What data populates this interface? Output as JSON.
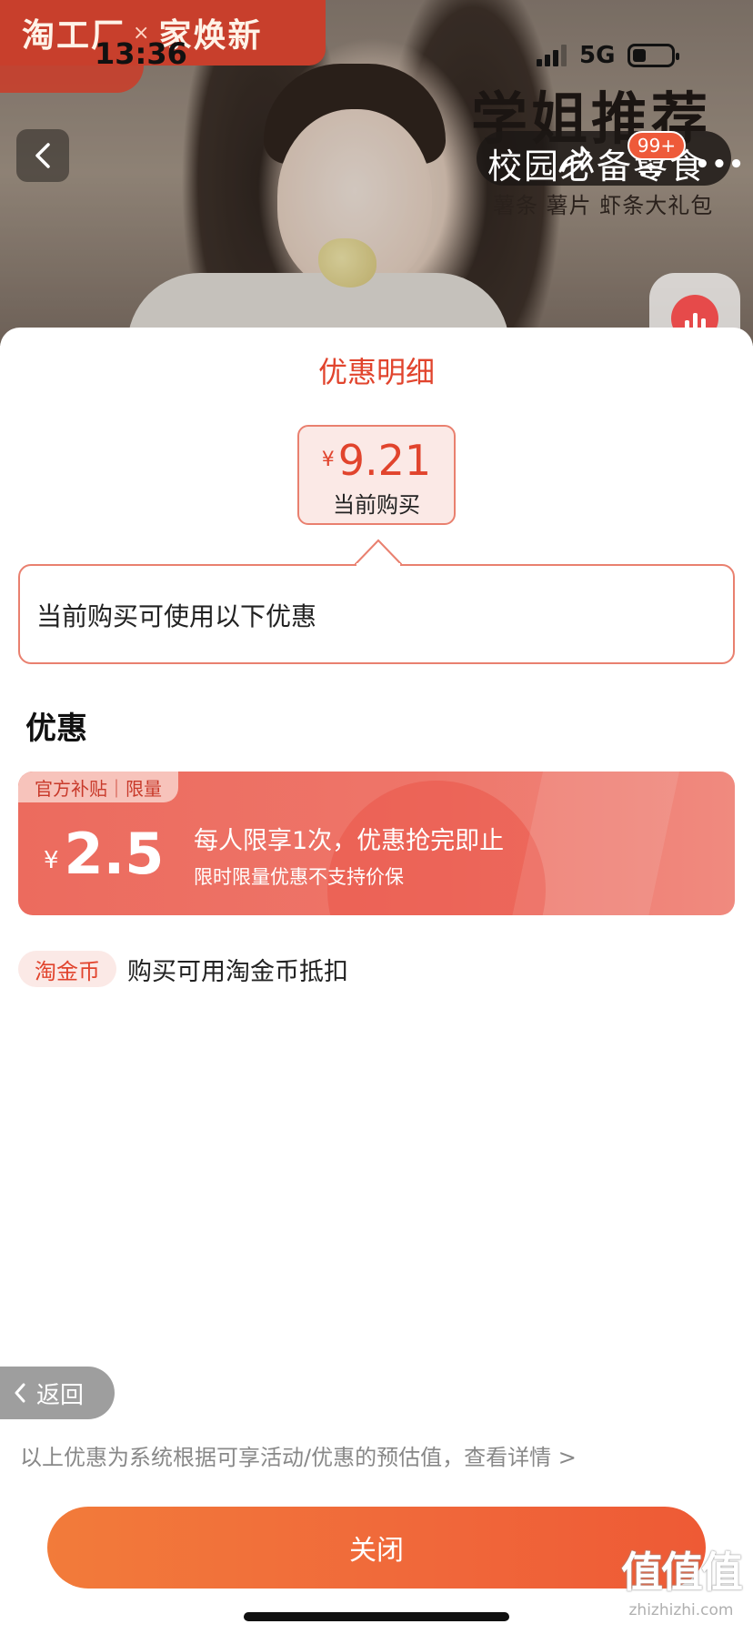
{
  "status_bar": {
    "time": "13:36",
    "network": "5G"
  },
  "banner": {
    "brand_left": "淘工厂",
    "brand_sep": "×",
    "brand_right": "家焕新",
    "promo_title": "学姐推荐",
    "promo_pill": "校园必备零食",
    "promo_sub": "薯条 薯片 虾条大礼包",
    "cart_badge": "99+"
  },
  "sheet": {
    "title": "优惠明细",
    "price": {
      "currency": "¥",
      "amount": "9.21",
      "caption": "当前购买"
    },
    "tip": "当前购买可使用以下优惠",
    "section_title": "优惠",
    "coupon": {
      "tag": "官方补贴｜限量",
      "currency": "¥",
      "amount": "2.5",
      "main_text": "每人限享1次，优惠抢完即止",
      "sub_text": "限时限量优惠不支持价保"
    },
    "coin": {
      "badge": "淘金币",
      "text": "购买可用淘金币抵扣"
    },
    "return_label": "返回",
    "footnote": "以上优惠为系统根据可享活动/优惠的预估值，查看详情 >",
    "close_label": "关闭"
  },
  "watermark": {
    "big": "值值值",
    "small": "zhizhizhi.com"
  },
  "colors": {
    "accent": "#e1442d",
    "coupon_bg": "#ec6b5e",
    "button_gradient_start": "#f27b3a",
    "button_gradient_end": "#ee5a35"
  }
}
